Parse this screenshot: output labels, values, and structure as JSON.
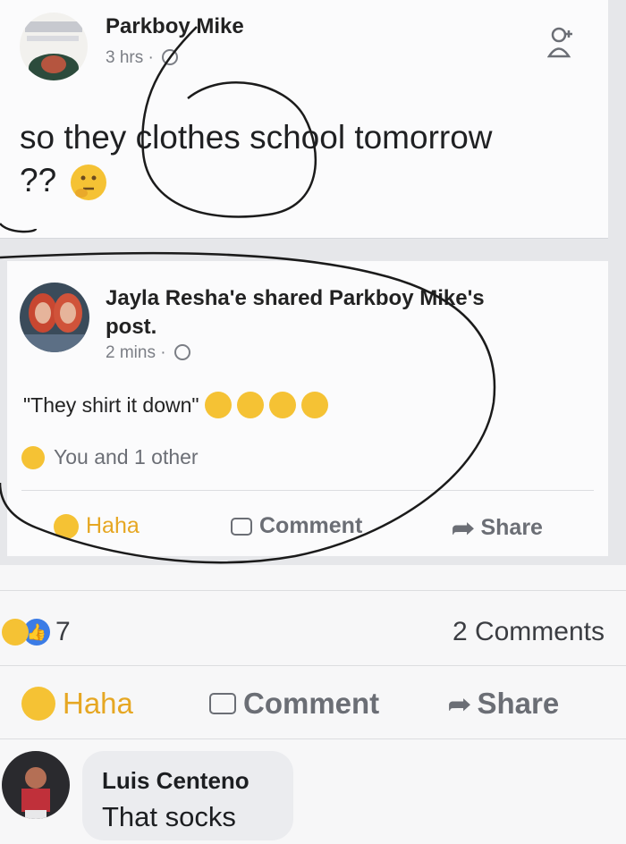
{
  "original_post": {
    "author": "Parkboy Mike",
    "time": "3 hrs",
    "text_line1": "so they clothes school tomorrow",
    "text_line2": "??",
    "add_friend_icon": "add-friend-icon"
  },
  "shared_post": {
    "author_line1": "Jayla Resha'e shared Parkboy Mike's",
    "author_line2": "post.",
    "time": "2 mins",
    "text": "\"They shirt it down\"",
    "reactions_text": "You and 1 other",
    "actions": {
      "haha": "Haha",
      "comment": "Comment",
      "share": "Share"
    }
  },
  "summary": {
    "reaction_count": "7",
    "comments_count": "2 Comments"
  },
  "main_actions": {
    "haha": "Haha",
    "comment": "Comment",
    "share": "Share"
  },
  "comment": {
    "author": "Luis Centeno",
    "text": "That socks"
  },
  "colors": {
    "accent_reaction": "#e6a723",
    "text_gray": "#6b6e75",
    "annotation": "#1b1b1b"
  }
}
